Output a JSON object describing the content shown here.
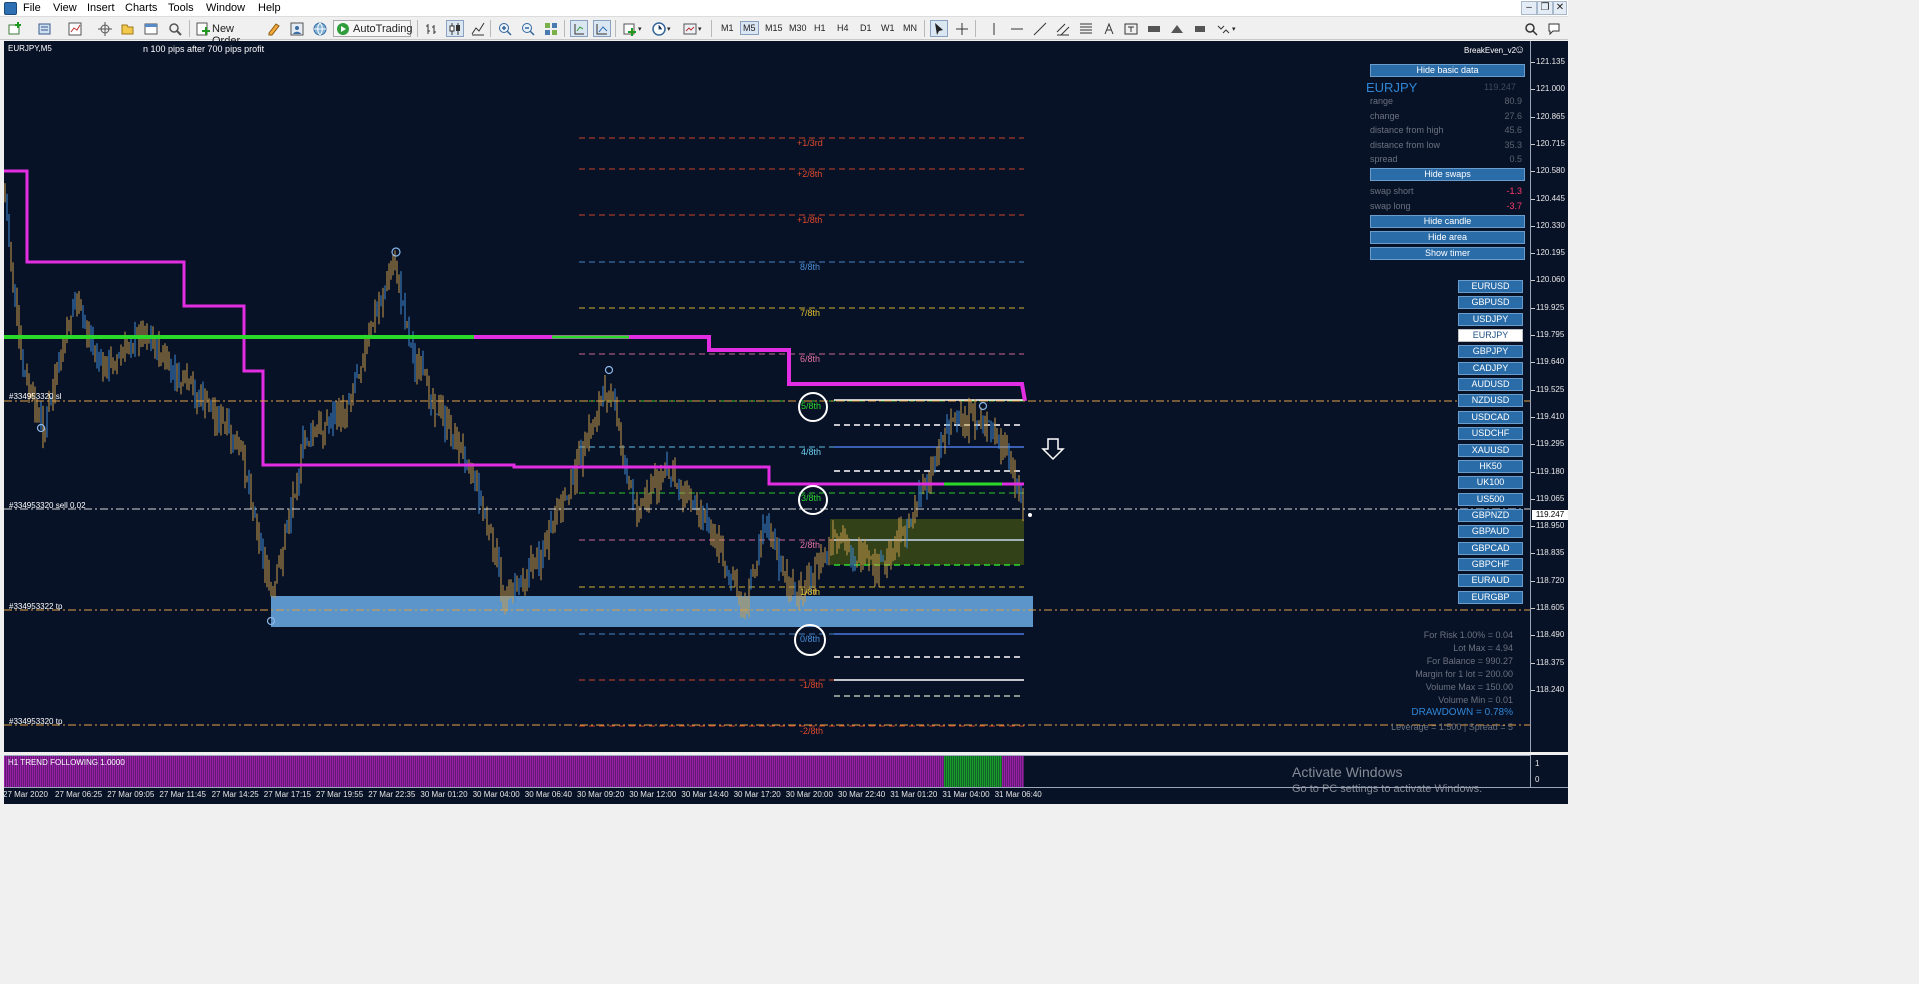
{
  "menubar": {
    "items": [
      "File",
      "View",
      "Insert",
      "Charts",
      "Tools",
      "Window",
      "Help"
    ]
  },
  "toolbar": {
    "new_order": "New Order",
    "autotrading": "AutoTrading",
    "timeframes": [
      "M1",
      "M5",
      "M15",
      "M30",
      "H1",
      "H4",
      "D1",
      "W1",
      "MN"
    ],
    "active_timeframe": "M5"
  },
  "chart": {
    "symbol_label": "EURJPY,M5",
    "comment": "n 100 pips after 700 pips profit",
    "indicator_label": "BreakEven_v2",
    "order_tags": [
      "#334953320 sl",
      "#334953320 sell 0.02",
      "#334953322 tp",
      "#334953320 tp"
    ],
    "murrey_labels": [
      "+1/3rd",
      "+2/8th",
      "+1/8th",
      "8/8th",
      "7/8th",
      "6/8th",
      "5/8th",
      "4/8th",
      "3/8th",
      "2/8th",
      "1/8th",
      "0/8th",
      "-1/8th",
      "-2/8th"
    ]
  },
  "price_axis": {
    "ticks": [
      "121.135",
      "121.000",
      "120.865",
      "120.715",
      "120.580",
      "120.445",
      "120.330",
      "120.195",
      "120.060",
      "119.925",
      "119.795",
      "119.640",
      "119.525",
      "119.410",
      "119.295",
      "119.180",
      "119.065",
      "118.950",
      "118.835",
      "118.720",
      "118.605",
      "118.490",
      "118.375",
      "118.240"
    ],
    "current_price": "119.247"
  },
  "time_axis": {
    "labels": [
      "27 Mar 2020",
      "27 Mar 06:25",
      "27 Mar 09:05",
      "27 Mar 11:45",
      "27 Mar 14:25",
      "27 Mar 17:15",
      "27 Mar 19:55",
      "27 Mar 22:35",
      "30 Mar 01:20",
      "30 Mar 04:00",
      "30 Mar 06:40",
      "30 Mar 09:20",
      "30 Mar 12:00",
      "30 Mar 14:40",
      "30 Mar 17:20",
      "30 Mar 20:00",
      "30 Mar 22:40",
      "31 Mar 01:20",
      "31 Mar 04:00",
      "31 Mar 06:40"
    ]
  },
  "info_panel": {
    "hide_basic_data": "Hide basic data",
    "symbol": "EURJPY",
    "symbol_price": "119.247",
    "rows": [
      {
        "label": "range",
        "value": "80.9"
      },
      {
        "label": "change",
        "value": "27.6"
      },
      {
        "label": "distance from high",
        "value": "45.6"
      },
      {
        "label": "distance from low",
        "value": "35.3"
      },
      {
        "label": "spread",
        "value": "0.5"
      }
    ],
    "hide_swaps": "Hide swaps",
    "swaps": [
      {
        "label": "swap short",
        "value": "-1.3"
      },
      {
        "label": "swap long",
        "value": "-3.7"
      }
    ],
    "hide_candle": "Hide candle",
    "hide_area": "Hide area",
    "show_timer": "Show timer",
    "swap_color": "#ff3b6b"
  },
  "pairs": [
    "EURUSD",
    "GBPUSD",
    "USDJPY",
    "EURJPY",
    "GBPJPY",
    "CADJPY",
    "AUDUSD",
    "NZDUSD",
    "USDCAD",
    "USDCHF",
    "XAUUSD",
    "HK50",
    "UK100",
    "US500",
    "GBPNZD",
    "GBPAUD",
    "GBPCAD",
    "GBPCHF",
    "EURAUD",
    "EURGBP"
  ],
  "selected_pair": "EURJPY",
  "risk_panel": {
    "lines": [
      "For Risk 1.00% = 0.04",
      "Lot Max = 4.94",
      "For Balance = 990.27",
      "Margin for 1 lot = 200.00",
      "Volume Max = 150.00",
      "Volume Min = 0.01"
    ],
    "drawdown": "DRAWDOWN =  0.78%",
    "leverage": "Leverage = 1:500 | Spread = 5"
  },
  "indicator_window": {
    "label": "H1 TREND FOLLOWING 1.0000",
    "axis_top": "1",
    "axis_bottom": "0"
  },
  "watermark": {
    "title": "Activate Windows",
    "subtitle": "Go to PC settings to activate Windows."
  },
  "colors": {
    "background": "#081227",
    "candle": "#c99a49",
    "candle_blue": "#3e8bd3",
    "magenta_line": "#e22de2",
    "green_line": "#2bd92b",
    "support_zone": "#5b95c9",
    "indicator_magenta": "#9a20a8",
    "indicator_green": "#1a9a2a"
  }
}
